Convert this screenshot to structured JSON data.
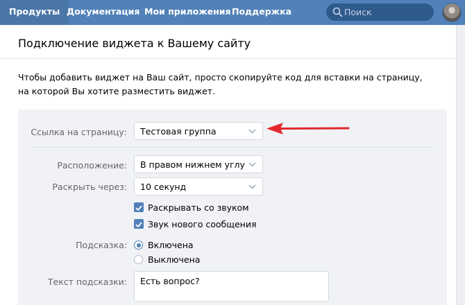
{
  "nav": {
    "items": [
      "Продукты",
      "Документация",
      "Мои приложения",
      "Поддержка"
    ],
    "active_index": 0,
    "search_placeholder": "Поиск"
  },
  "page": {
    "title": "Подключение виджета к Вашему сайту",
    "description": "Чтобы добавить виджет на Ваш сайт, просто скопируйте код для вставки на страницу, на которой Вы хотите разместить виджет."
  },
  "form": {
    "page_link": {
      "label": "Ссылка на страницу:",
      "value": "Тестовая группа"
    },
    "position": {
      "label": "Расположение:",
      "value": "В правом нижнем углу"
    },
    "expand_after": {
      "label": "Раскрыть через:",
      "value": "10 секунд"
    },
    "checkboxes": [
      {
        "label": "Раскрывать со звуком",
        "checked": true
      },
      {
        "label": "Звук нового сообщения",
        "checked": true
      }
    ],
    "hint": {
      "label": "Подсказка:",
      "options": [
        {
          "label": "Включена",
          "selected": true
        },
        {
          "label": "Выключена",
          "selected": false
        }
      ]
    },
    "hint_text": {
      "label": "Текст подсказки:",
      "value": "Есть вопрос?"
    }
  },
  "colors": {
    "header": "#5181b8",
    "accent": "#5181b8",
    "annotation_arrow": "#e0282d"
  }
}
